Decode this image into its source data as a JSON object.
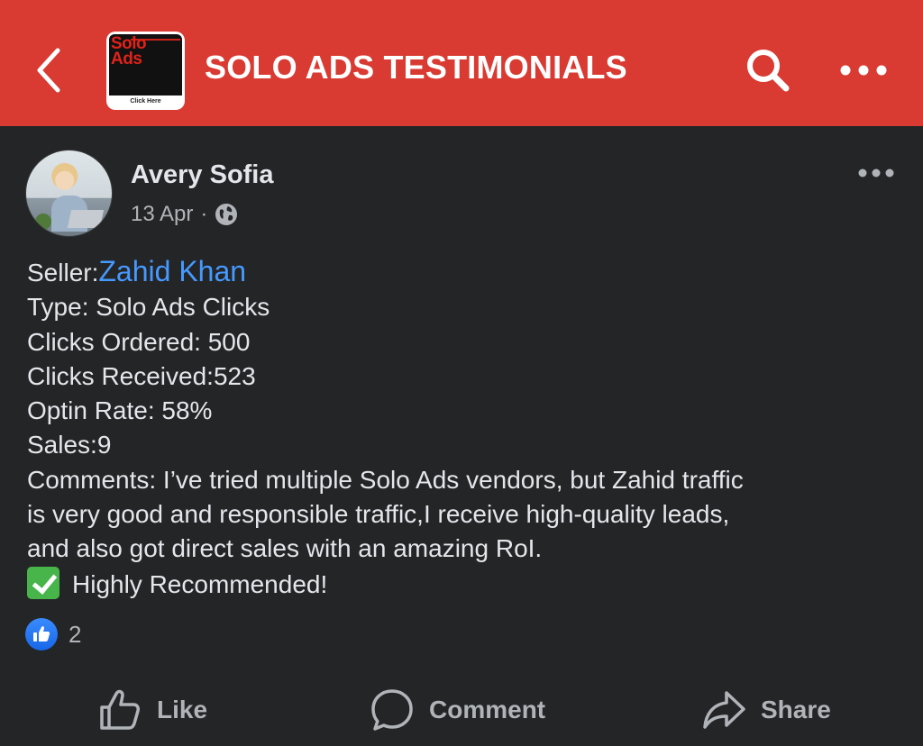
{
  "header": {
    "title": "SOLO ADS TESTIMONIALS",
    "group_thumbnail": {
      "line1": "Solo",
      "line2": "Ads",
      "cta": "Click Here"
    },
    "bg_color": "#d93a32"
  },
  "post": {
    "author": "Avery Sofia",
    "date": "13 Apr",
    "separator": "·",
    "privacy_icon": "globe-icon",
    "seller_label": "Seller:",
    "seller_name": "Zahid Khan",
    "lines": [
      "Type: Solo Ads Clicks",
      "Clicks Ordered: 500",
      "Clicks Received:523",
      "Optin Rate: 58%",
      "Sales:9",
      "Comments: I’ve tried multiple Solo Ads vendors, but Zahid traffic",
      "is very good and responsible traffic,I receive high-quality leads,",
      "and also got direct sales with an amazing RoI."
    ],
    "recommend_text": "Highly Recommended!",
    "reaction_count": "2"
  },
  "actions": {
    "like": "Like",
    "comment": "Comment",
    "share": "Share"
  },
  "colors": {
    "background": "#242526",
    "text": "#e4e6eb",
    "secondary_text": "#b0b3b8",
    "link": "#4599ff",
    "like_blue": "#1877f2",
    "check_green": "#47b54a"
  }
}
